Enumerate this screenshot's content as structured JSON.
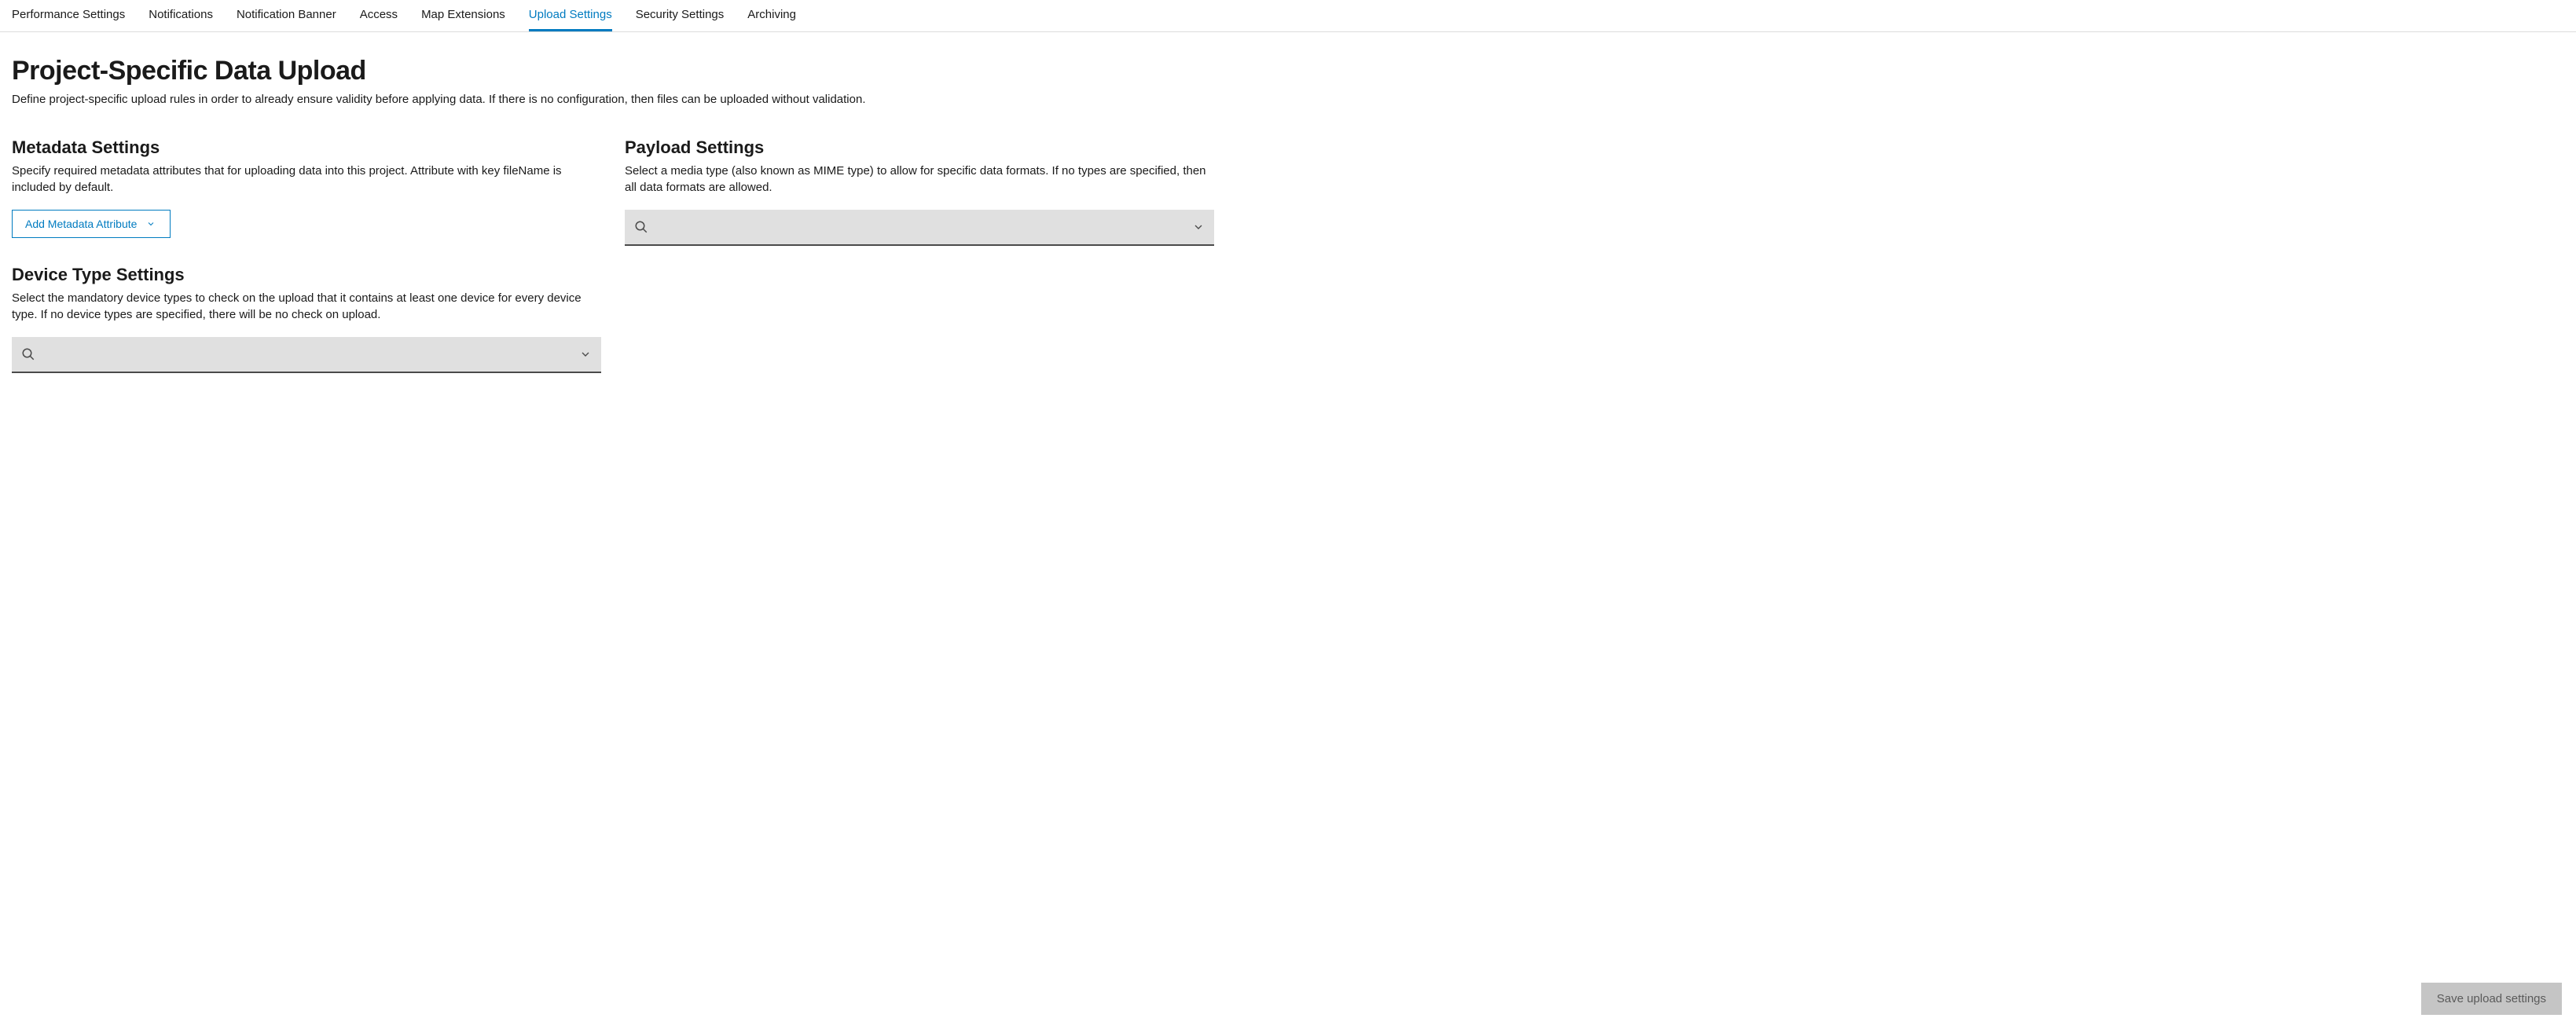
{
  "tabs": [
    {
      "label": "Performance Settings",
      "active": false
    },
    {
      "label": "Notifications",
      "active": false
    },
    {
      "label": "Notification Banner",
      "active": false
    },
    {
      "label": "Access",
      "active": false
    },
    {
      "label": "Map Extensions",
      "active": false
    },
    {
      "label": "Upload Settings",
      "active": true
    },
    {
      "label": "Security Settings",
      "active": false
    },
    {
      "label": "Archiving",
      "active": false
    }
  ],
  "page": {
    "title": "Project-Specific Data Upload",
    "description": "Define project-specific upload rules in order to already ensure validity before applying data. If there is no configuration, then files can be uploaded without validation."
  },
  "metadata": {
    "title": "Metadata Settings",
    "description": "Specify required metadata attributes that for uploading data into this project. Attribute with key fileName is included by default.",
    "button_label": "Add Metadata Attribute"
  },
  "deviceType": {
    "title": "Device Type Settings",
    "description": "Select the mandatory device types to check on the upload that it contains at least one device for every device type. If no device types are specified, there will be no check on upload.",
    "search_placeholder": ""
  },
  "payload": {
    "title": "Payload Settings",
    "description": "Select a media type (also known as MIME type) to allow for specific data formats. If no types are specified, then all data formats are allowed.",
    "search_placeholder": ""
  },
  "save": {
    "label": "Save upload settings"
  }
}
